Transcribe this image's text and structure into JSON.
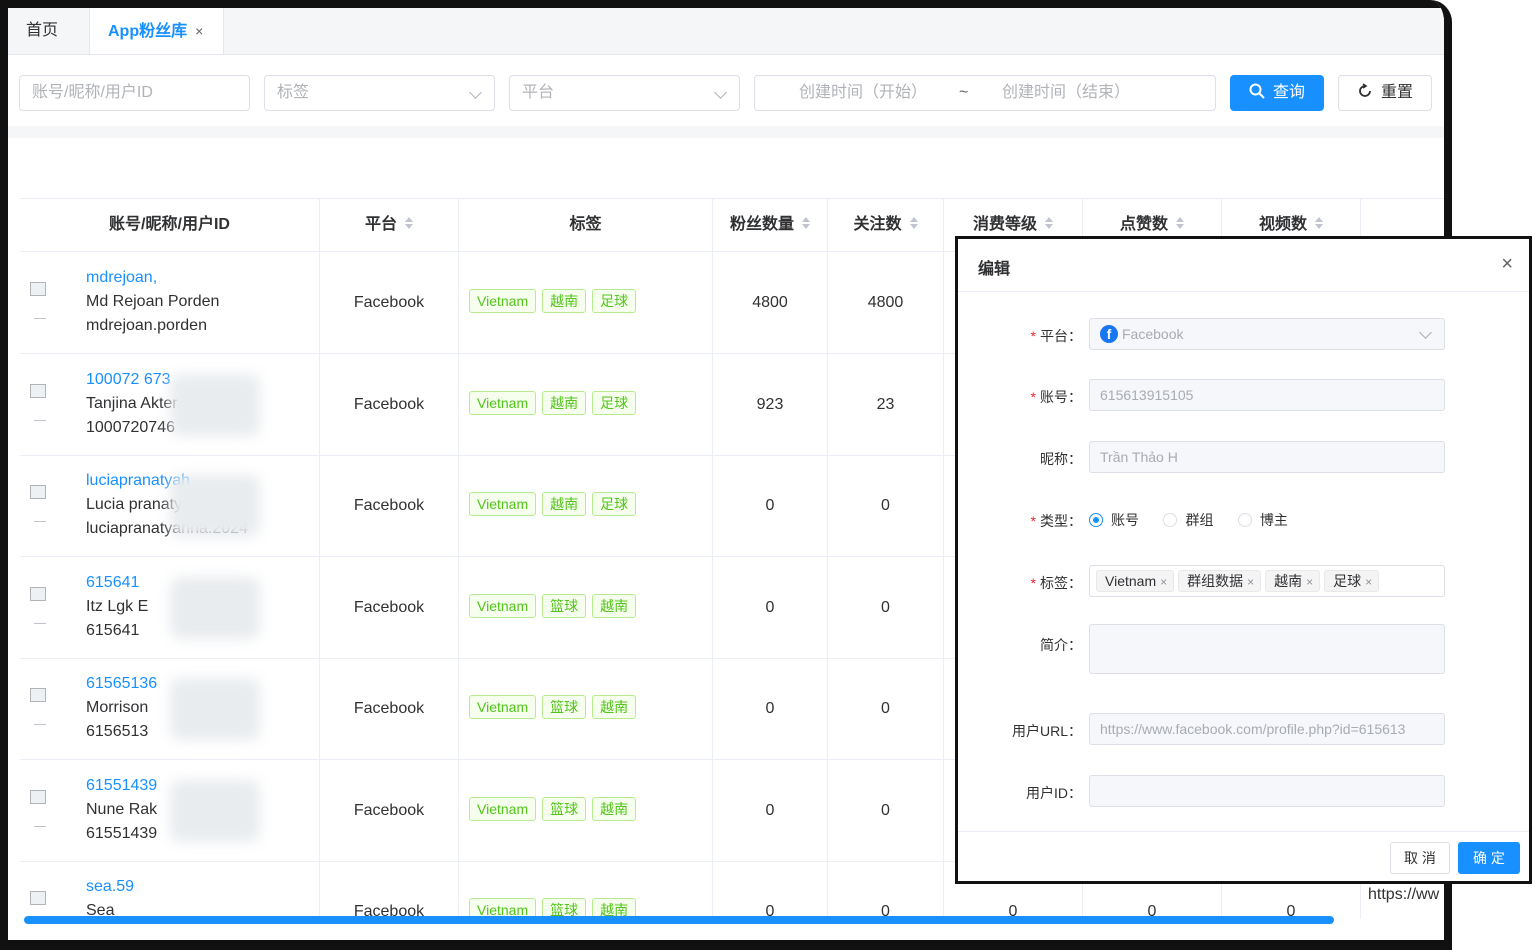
{
  "tabs": {
    "home": "首页",
    "active": "App粉丝库",
    "close": "×"
  },
  "filters": {
    "account_placeholder": "账号/昵称/用户ID",
    "tag_placeholder": "标签",
    "platform_placeholder": "平台",
    "start_placeholder": "创建时间（开始）",
    "range_sep": "~",
    "end_placeholder": "创建时间（结束）",
    "search_label": "查询",
    "reset_label": "重置"
  },
  "table": {
    "headers": [
      "账号/昵称/用户ID",
      "平台",
      "标签",
      "粉丝数量",
      "关注数",
      "消费等级",
      "点赞数",
      "视频数"
    ],
    "rows": [
      {
        "line1": "mdrejoan,",
        "line2": "Md Rejoan Porden",
        "line3": "mdrejoan.porden",
        "platform": "Facebook",
        "tags": [
          "Vietnam",
          "越南",
          "足球"
        ],
        "fans": "4800",
        "follows": "4800"
      },
      {
        "line1": "100072 673",
        "line2": "Tanjina Akter",
        "line3": "1000720746",
        "platform": "Facebook",
        "tags": [
          "Vietnam",
          "越南",
          "足球"
        ],
        "fans": "923",
        "follows": "23"
      },
      {
        "line1": "luciapranatyah",
        "line2": "Lucia pranatysti",
        "line3": "luciapranatyahna.2024",
        "platform": "Facebook",
        "tags": [
          "Vietnam",
          "越南",
          "足球"
        ],
        "fans": "0",
        "follows": "0"
      },
      {
        "line1": "615641",
        "line2": "Itz Lgk E",
        "line3": "615641",
        "platform": "Facebook",
        "tags": [
          "Vietnam",
          "篮球",
          "越南"
        ],
        "fans": "0",
        "follows": "0"
      },
      {
        "line1": "61565136",
        "line2": "Morrison",
        "line3": "6156513",
        "platform": "Facebook",
        "tags": [
          "Vietnam",
          "篮球",
          "越南"
        ],
        "fans": "0",
        "follows": "0"
      },
      {
        "line1": "61551439",
        "line2": "Nune Rak",
        "line3": "61551439",
        "platform": "Facebook",
        "tags": [
          "Vietnam",
          "篮球",
          "越南"
        ],
        "fans": "0",
        "follows": "0"
      },
      {
        "line1": "sea.59",
        "line2": "Sea",
        "line3": "",
        "platform": "Facebook",
        "tags": [
          "Vietnam",
          "篮球",
          "越南"
        ],
        "fans": "0",
        "follows": "0",
        "consume": "0",
        "likes": "0",
        "videos": "0"
      }
    ],
    "url_peek": "https://ww"
  },
  "modal": {
    "title": "编辑",
    "close": "×",
    "platform_label": "平台：",
    "platform_value": "Facebook",
    "account_label": "账号：",
    "account_value": "615613915105",
    "nickname_label": "昵称：",
    "nickname_value": "Trần Thảo H",
    "type_label": "类型：",
    "type_options": [
      "账号",
      "群组",
      "博主"
    ],
    "type_selected": "账号",
    "tags_label": "标签：",
    "tags": [
      "Vietnam",
      "群组数据",
      "越南",
      "足球"
    ],
    "bio_label": "简介：",
    "bio_value": "",
    "url_label": "用户URL：",
    "url_value": "https://www.facebook.com/profile.php?id=615613",
    "uid_label": "用户ID：",
    "uid_value": "",
    "cancel_label": "取 消",
    "confirm_label": "确 定"
  },
  "colors": {
    "primary": "#1890ff",
    "tag_green": "#52c41a",
    "required": "#f5222d"
  }
}
